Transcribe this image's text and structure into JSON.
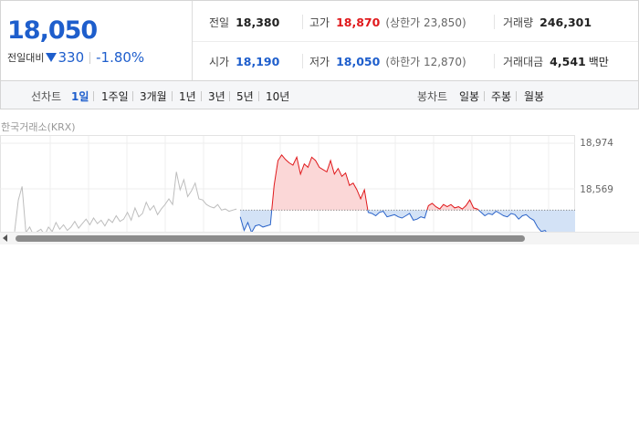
{
  "summary": {
    "current_price": "18,050",
    "change_label": "전일대비",
    "change_direction_icon": "down-triangle-icon",
    "change_amount": "330",
    "change_rate": "-1.80%",
    "colors": {
      "up": "#e0191c",
      "down": "#1e5ecc"
    },
    "stats": {
      "prev_close": {
        "label": "전일",
        "value": "18,380"
      },
      "high": {
        "label": "고가",
        "value": "18,870",
        "limit_label": "(상한가 23,850)"
      },
      "volume": {
        "label": "거래량",
        "value": "246,301"
      },
      "open": {
        "label": "시가",
        "value": "18,190"
      },
      "low": {
        "label": "저가",
        "value": "18,050",
        "limit_label": "(하한가 12,870)"
      },
      "trade_value": {
        "label": "거래대금",
        "value": "4,541",
        "unit": "백만"
      }
    }
  },
  "toolbar": {
    "line_chart_label": "선차트",
    "periods": [
      "1일",
      "1주일",
      "3개월",
      "1년",
      "3년",
      "5년",
      "10년"
    ],
    "active_period": "1일",
    "candle_chart_label": "봉차트",
    "candle_periods": [
      "일봉",
      "주봉",
      "월봉"
    ]
  },
  "chart": {
    "source_label": "한국거래소(KRX)",
    "y_tick_labels": [
      "18,974",
      "18,569"
    ],
    "reference_price": 18380,
    "colors": {
      "history": "#bdbdbd",
      "up_line": "#e0191c",
      "up_fill": "#fbd7d7",
      "down_line": "#2a63c9",
      "down_fill": "#d3e2f6"
    }
  },
  "chart_data": {
    "type": "line",
    "title": "",
    "xlabel": "",
    "ylabel": "",
    "ylim": [
      18150,
      18974
    ],
    "y_ticks": [
      18974,
      18569
    ],
    "reference_line": 18380,
    "series": [
      {
        "x": [
          0,
          1,
          2,
          3,
          4,
          5,
          6,
          7,
          8,
          9,
          10,
          11,
          12,
          13,
          14,
          15,
          16,
          17,
          18,
          19,
          20,
          21,
          22,
          23,
          24,
          25,
          26,
          27,
          28,
          29,
          30,
          31,
          32,
          33,
          34,
          35,
          36,
          37,
          38,
          39,
          40,
          41,
          42,
          43,
          44,
          45,
          46,
          47,
          48,
          49,
          50,
          51,
          52,
          53,
          54,
          55,
          56,
          57,
          58,
          59
        ],
        "y": [
          18190,
          18470,
          18590,
          18180,
          18230,
          18160,
          18190,
          18210,
          18160,
          18230,
          18190,
          18270,
          18210,
          18250,
          18200,
          18230,
          18280,
          18220,
          18260,
          18300,
          18250,
          18310,
          18260,
          18290,
          18240,
          18300,
          18270,
          18330,
          18280,
          18300,
          18360,
          18290,
          18400,
          18320,
          18350,
          18450,
          18380,
          18420,
          18340,
          18390,
          18430,
          18480,
          18430,
          18720,
          18560,
          18650,
          18500,
          18550,
          18620,
          18480,
          18470,
          18430,
          18410,
          18400,
          18430,
          18380,
          18390,
          18370,
          18380,
          18390
        ]
      },
      {
        "x": [
          60,
          61,
          62,
          63,
          64,
          65,
          66,
          67,
          68,
          69,
          70,
          71,
          72,
          73,
          74,
          75,
          76,
          77,
          78,
          79,
          80,
          81,
          82,
          83,
          84,
          85,
          86,
          87,
          88,
          89,
          90,
          91,
          92,
          93,
          94,
          95,
          96,
          97,
          98,
          99,
          100,
          101,
          102,
          103,
          104,
          105,
          106,
          107,
          108,
          109,
          110,
          111,
          112,
          113,
          114,
          115,
          116,
          117,
          118,
          119,
          120,
          121,
          122,
          123,
          124,
          125,
          126,
          127,
          128,
          129,
          130,
          131,
          132,
          133,
          134,
          135,
          136,
          137,
          138,
          139,
          140,
          141,
          142,
          143,
          144,
          145,
          146,
          147,
          148,
          149
        ],
        "y": [
          18320,
          18200,
          18270,
          18180,
          18240,
          18250,
          18230,
          18240,
          18250,
          18600,
          18820,
          18870,
          18830,
          18800,
          18780,
          18850,
          18700,
          18790,
          18760,
          18850,
          18820,
          18760,
          18740,
          18720,
          18820,
          18700,
          18750,
          18680,
          18710,
          18600,
          18620,
          18560,
          18480,
          18560,
          18360,
          18350,
          18330,
          18360,
          18370,
          18320,
          18330,
          18340,
          18320,
          18310,
          18330,
          18350,
          18290,
          18300,
          18320,
          18310,
          18420,
          18440,
          18410,
          18390,
          18430,
          18410,
          18430,
          18400,
          18410,
          18390,
          18420,
          18470,
          18400,
          18390,
          18360,
          18330,
          18350,
          18340,
          18370,
          18350,
          18330,
          18320,
          18350,
          18340,
          18300,
          18330,
          18340,
          18310,
          18290,
          18230,
          18190,
          18200,
          18160,
          18170,
          18130,
          18160,
          18140,
          18130,
          18120,
          18100
        ]
      }
    ]
  }
}
